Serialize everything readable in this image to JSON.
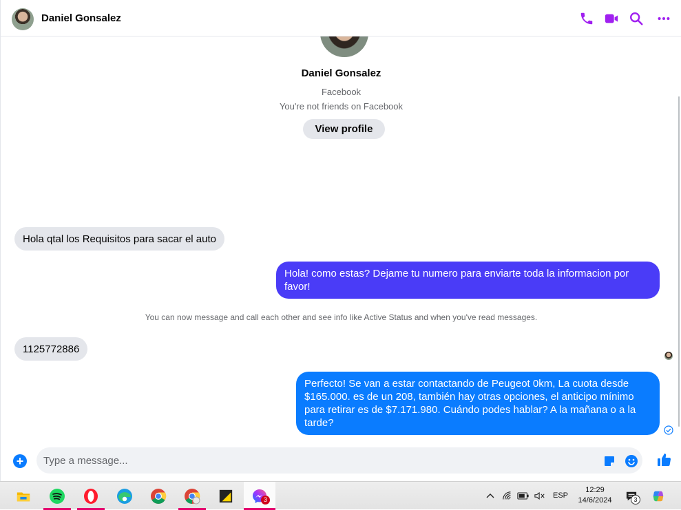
{
  "header": {
    "contact_name": "Daniel Gonsalez",
    "icons": [
      "phone-icon",
      "video-camera-icon",
      "search-icon",
      "more-icon"
    ],
    "accent": "#a020f0"
  },
  "profile": {
    "name": "Daniel Gonsalez",
    "platform": "Facebook",
    "friend_status": "You're not friends on Facebook",
    "view_profile_label": "View profile"
  },
  "messages": [
    {
      "direction": "incoming",
      "text": "Hola qtal los Requisitos para sacar el auto"
    },
    {
      "direction": "outgoing",
      "text": "Hola! como estas? Dejame tu numero para enviarte toda la informacion por favor!"
    },
    {
      "direction": "incoming",
      "text": "1125772886"
    },
    {
      "direction": "outgoing",
      "text": "Perfecto!  Se van a estar contactando de Peugeot 0km, La cuota desde $165.000. es de un 208, también hay otras opciones, el anticipo mínimo para retirar es de $7.171.980. Cuándo podes hablar? A la mañana o a la tarde?"
    }
  ],
  "system_note": "You can now message and call each other and see info like Active Status and when you've read messages.",
  "composer": {
    "placeholder": "Type a message...",
    "value": ""
  },
  "colors": {
    "outgoing_bubble_1": "#4a3cf7",
    "outgoing_bubble_2": "#0a7cff",
    "incoming_bubble": "#e4e6eb",
    "brand_blue": "#0a7cff"
  },
  "taskbar": {
    "apps": [
      "file-explorer-icon",
      "spotify-icon",
      "opera-icon",
      "edge-icon",
      "chrome-icon",
      "chrome-profile-icon",
      "sticky-notes-icon",
      "messenger-icon"
    ],
    "messenger_badge": "3",
    "language": "ESP",
    "time": "12:29",
    "date": "14/6/2024",
    "notification_count": "3"
  }
}
